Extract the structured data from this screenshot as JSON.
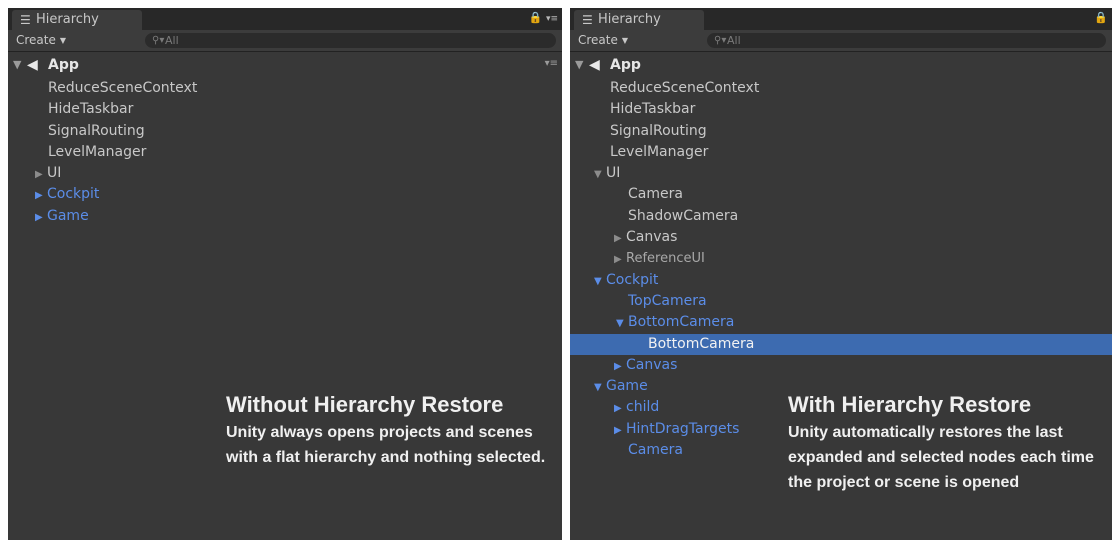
{
  "left": {
    "tab_label": "Hierarchy",
    "tab_icon": "list-icon",
    "lock_glyph": "🔒",
    "menu_glyph": "▾≡",
    "create_label": "Create",
    "search_placeholder": "All",
    "scene": "App",
    "items": [
      {
        "label": "ReduceSceneContext"
      },
      {
        "label": "HideTaskbar"
      },
      {
        "label": "SignalRouting"
      },
      {
        "label": "LevelManager"
      },
      {
        "label": "UI"
      },
      {
        "label": "Cockpit"
      },
      {
        "label": "Game"
      }
    ],
    "caption_title": "Without Hierarchy Restore",
    "caption_body": "Unity always opens projects and scenes with a flat hierarchy and nothing selected."
  },
  "right": {
    "tab_label": "Hierarchy",
    "tab_icon": "list-icon",
    "lock_glyph": "🔒",
    "create_label": "Create",
    "search_placeholder": "All",
    "scene": "App",
    "items": [
      {
        "label": "ReduceSceneContext"
      },
      {
        "label": "HideTaskbar"
      },
      {
        "label": "SignalRouting"
      },
      {
        "label": "LevelManager"
      },
      {
        "label": "UI"
      },
      {
        "label": "Camera"
      },
      {
        "label": "ShadowCamera"
      },
      {
        "label": "Canvas"
      },
      {
        "label": "ReferenceUI"
      },
      {
        "label": "Cockpit"
      },
      {
        "label": "TopCamera"
      },
      {
        "label": "BottomCamera"
      },
      {
        "label": "BottomCamera"
      },
      {
        "label": "Canvas"
      },
      {
        "label": "Game"
      },
      {
        "label": "child"
      },
      {
        "label": "HintDragTargets"
      },
      {
        "label": "Camera"
      }
    ],
    "caption_title": "With Hierarchy Restore",
    "caption_body": "Unity automatically restores the last expanded and selected nodes each time the project or scene is opened"
  },
  "colors": {
    "panel_bg": "#383838",
    "prefab_blue": "#5b8de8",
    "selection": "#3d6bb0"
  }
}
